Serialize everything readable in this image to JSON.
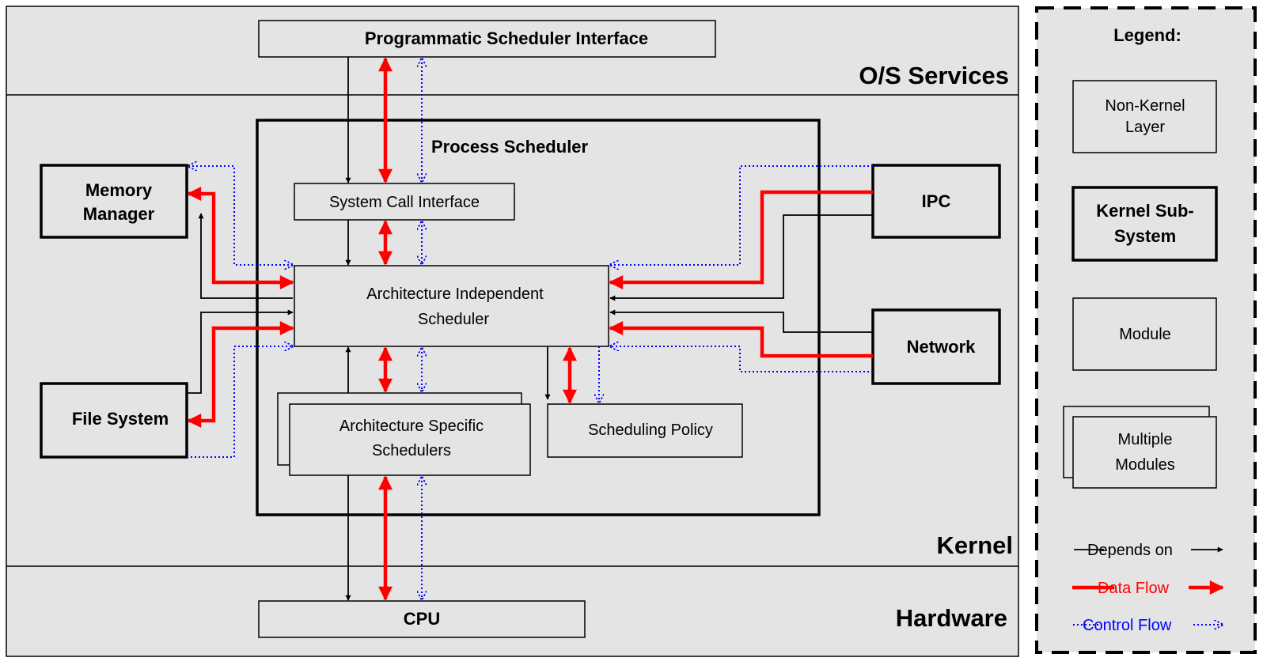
{
  "layers": {
    "os_services": "O/S Services",
    "kernel": "Kernel",
    "hardware": "Hardware"
  },
  "boxes": {
    "programmatic_interface": "Programmatic Scheduler Interface",
    "process_scheduler": "Process Scheduler",
    "system_call_interface": "System Call Interface",
    "arch_independent": [
      "Architecture Independent",
      "Scheduler"
    ],
    "arch_specific": [
      "Architecture Specific",
      "Schedulers"
    ],
    "scheduling_policy": "Scheduling Policy",
    "memory_manager": [
      "Memory",
      "Manager"
    ],
    "file_system": "File System",
    "ipc": "IPC",
    "network": "Network",
    "cpu": "CPU"
  },
  "legend": {
    "title": "Legend:",
    "non_kernel": [
      "Non-Kernel",
      "Layer"
    ],
    "kernel_subsystem": [
      "Kernel Sub-",
      "System"
    ],
    "module": "Module",
    "multiple_modules": [
      "Multiple",
      "Modules"
    ],
    "depends_on": "Depends on",
    "data_flow": "Data Flow",
    "control_flow": "Control Flow"
  },
  "colors": {
    "depends": "#000000",
    "data_flow": "#ff0000",
    "control_flow": "#0000ff",
    "background": "#e4e4e4"
  }
}
